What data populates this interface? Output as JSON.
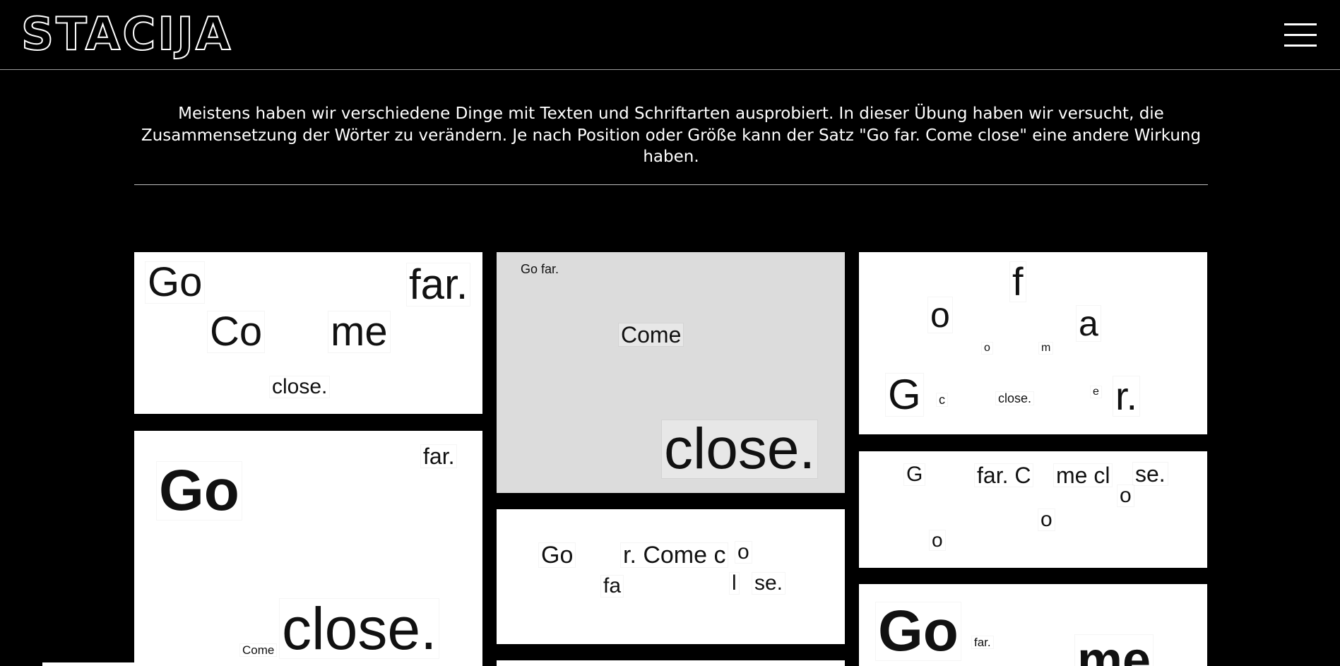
{
  "header": {
    "logo": "STACIJA",
    "menu_icon": "hamburger-menu-icon"
  },
  "intro": {
    "text": "Meistens haben wir verschiedene Dinge mit Texten und Schriftarten ausprobiert. In dieser Übung haben wir versucht, die Zusammensetzung der Wörter zu verändern. Je nach Position oder Größe kann der Satz \"Go far. Come close\" eine andere Wirkung haben."
  },
  "tiles": {
    "t1": {
      "w1": "Go",
      "w2": "far.",
      "w3": "Co",
      "w4": "me",
      "w5": "close."
    },
    "t2": {
      "w1": "far.",
      "w2": "Go",
      "w3": "Come",
      "w4": "close."
    },
    "t3": {
      "w1": "Go far.",
      "w2": "Come",
      "w3": "close."
    },
    "t4": {
      "w1": "Go",
      "w2": "r. Come c",
      "w3": "o",
      "w4": "fa",
      "w5": "l",
      "w6": "se."
    },
    "t5": {
      "w1": "f",
      "w2": "o",
      "w3": "a",
      "w4": "o",
      "w5": "m",
      "w6": "G",
      "w7": "c",
      "w8": "close.",
      "w9": "e",
      "w10": "r."
    },
    "t6": {
      "w1": "G",
      "w2": "far. C",
      "w3": "me cl",
      "w4": "se.",
      "w5": "o",
      "w6": "o",
      "w7": "o"
    },
    "t7": {
      "w1": "Go",
      "w2": "far.",
      "w3": "me"
    }
  },
  "colors": {
    "background": "#000000",
    "text": "#ffffff",
    "tile": "#ffffff",
    "tile_gray": "#dcdcdc",
    "ink": "#111111"
  }
}
